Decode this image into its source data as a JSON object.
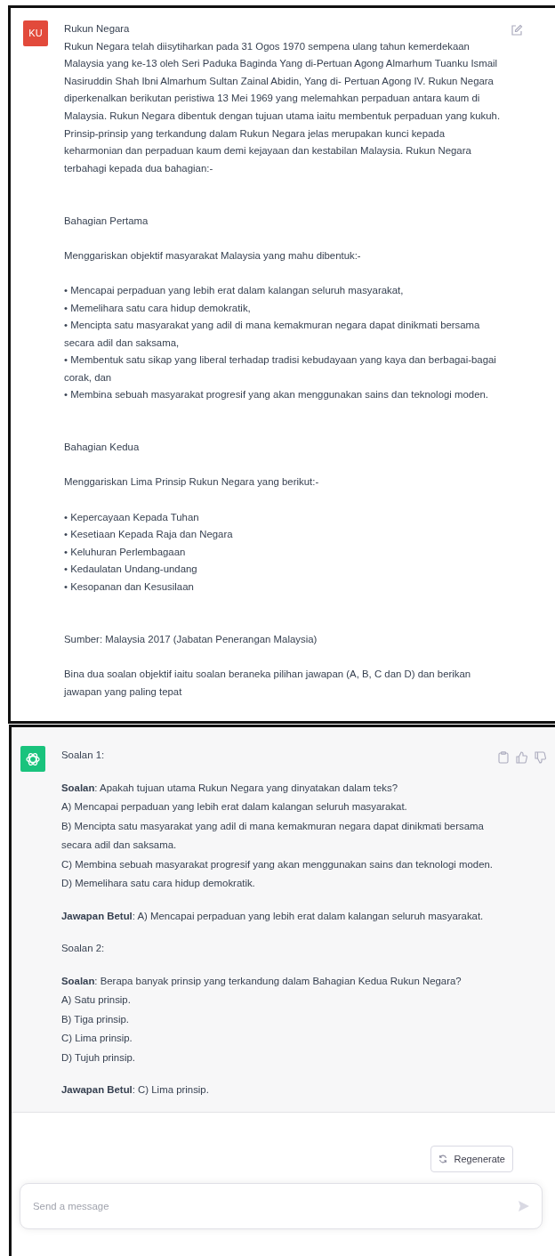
{
  "user_message": {
    "avatar_initials": "KU",
    "blocks": [
      {
        "kind": "paragraph",
        "lines": [
          "Rukun Negara",
          "Rukun Negara telah diisytiharkan pada 31 Ogos 1970 sempena ulang tahun kemerdekaan Malaysia yang ke-13 oleh Seri Paduka Baginda Yang di-Pertuan Agong Almarhum Tuanku Ismail Nasiruddin Shah Ibni Almarhum Sultan Zainal Abidin, Yang di- Pertuan Agong IV. Rukun Negara diperkenalkan berikutan peristiwa 13 Mei 1969 yang melemahkan perpaduan antara kaum di Malaysia. Rukun Negara dibentuk dengan tujuan utama iaitu membentuk perpaduan yang kukuh. Prinsip-prinsip yang terkandung dalam Rukun Negara jelas merupakan kunci kepada keharmonian dan perpaduan kaum demi kejayaan dan kestabilan Malaysia. Rukun Negara terbahagi kepada dua bahagian:-"
        ]
      },
      {
        "kind": "section",
        "lines": [
          "Bahagian Pertama"
        ]
      },
      {
        "kind": "paragraph",
        "lines": [
          "Menggariskan objektif masyarakat Malaysia yang mahu dibentuk:-"
        ]
      },
      {
        "kind": "paragraph",
        "lines": [
          "• Mencapai perpaduan yang lebih erat dalam kalangan seluruh masyarakat,",
          "• Memelihara satu cara hidup demokratik,",
          "• Mencipta satu masyarakat yang adil di mana kemakmuran negara dapat dinikmati bersama secara adil dan saksama,",
          "• Membentuk satu sikap yang liberal terhadap tradisi kebudayaan yang kaya dan berbagai-bagai corak, dan",
          "• Membina sebuah masyarakat progresif yang akan menggunakan sains dan teknologi moden."
        ]
      },
      {
        "kind": "section",
        "lines": [
          "Bahagian Kedua"
        ]
      },
      {
        "kind": "paragraph",
        "lines": [
          "Menggariskan Lima Prinsip Rukun Negara yang berikut:-"
        ]
      },
      {
        "kind": "paragraph",
        "lines": [
          "• Kepercayaan Kepada Tuhan",
          "• Kesetiaan Kepada Raja dan Negara",
          "• Keluhuran Perlembagaan",
          "• Kedaulatan Undang-undang",
          "• Kesopanan dan Kesusilaan"
        ]
      },
      {
        "kind": "section",
        "lines": [
          "Sumber: Malaysia 2017 (Jabatan Penerangan Malaysia)"
        ]
      },
      {
        "kind": "paragraph",
        "lines": [
          "Bina dua soalan objektif iaitu soalan beraneka pilihan jawapan (A, B, C dan D) dan berikan jawapan yang paling tepat"
        ]
      }
    ]
  },
  "assistant_message": {
    "blocks": [
      {
        "kind": "paragraph",
        "lines": [
          "Soalan 1:"
        ]
      },
      {
        "kind": "paragraph",
        "lines": [
          "**Soalan**: Apakah tujuan utama Rukun Negara yang dinyatakan dalam teks?",
          "A) Mencapai perpaduan yang lebih erat dalam kalangan seluruh masyarakat.",
          "B) Mencipta satu masyarakat yang adil di mana kemakmuran negara dapat dinikmati bersama secara adil dan saksama.",
          "C) Membina sebuah masyarakat progresif yang akan menggunakan sains dan teknologi moden.",
          "D) Memelihara satu cara hidup demokratik."
        ]
      },
      {
        "kind": "paragraph",
        "lines": [
          "**Jawapan Betul**: A) Mencapai perpaduan yang lebih erat dalam kalangan seluruh masyarakat."
        ]
      },
      {
        "kind": "paragraph",
        "lines": [
          "Soalan 2:"
        ]
      },
      {
        "kind": "paragraph",
        "lines": [
          "**Soalan**: Berapa banyak prinsip yang terkandung dalam Bahagian Kedua Rukun Negara?",
          "A) Satu prinsip.",
          "B) Tiga prinsip.",
          "C) Lima prinsip.",
          "D) Tujuh prinsip."
        ]
      },
      {
        "kind": "paragraph",
        "lines": [
          "**Jawapan Betul**: C) Lima prinsip."
        ]
      }
    ]
  },
  "regenerate_button": {
    "label": "Regenerate"
  },
  "composer": {
    "placeholder": "Send a message"
  }
}
